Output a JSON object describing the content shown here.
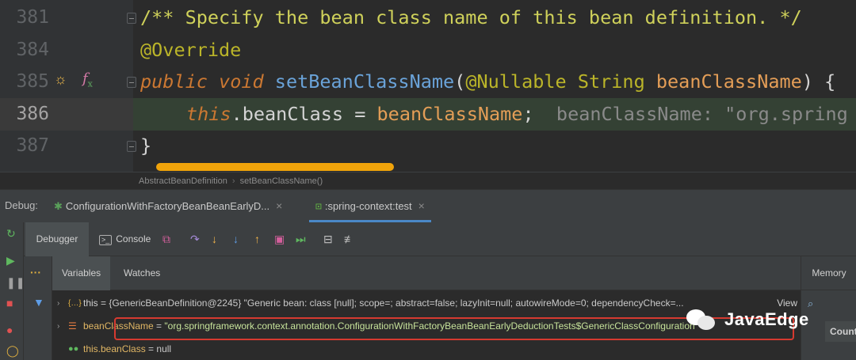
{
  "editor": {
    "lines": [
      {
        "num": "381",
        "doc": "/** Specify the bean class name of this bean definition. */"
      },
      {
        "num": "384",
        "annotation": "@Override"
      },
      {
        "num": "385",
        "kw_public": "public",
        "kw_void": "void",
        "method": "setBeanClassName",
        "open": "(",
        "nullable": "@Nullable",
        "type": "String",
        "param": "beanClassName",
        "close": ") {"
      },
      {
        "num": "386",
        "this": "this",
        "dot_field": ".beanClass",
        "assign": " = ",
        "value": "beanClassName",
        "semi": ";",
        "hint": "beanClassName: \"org.spring"
      },
      {
        "num": "387",
        "brace": "}"
      }
    ]
  },
  "breadcrumb": {
    "cls": "AbstractBeanDefinition",
    "sep": "›",
    "method": "setBeanClassName()"
  },
  "debug": {
    "label": "Debug:",
    "tabs": [
      {
        "label": "ConfigurationWithFactoryBeanBeanEarlyD...",
        "close": "×"
      },
      {
        "label": ":spring-context:test",
        "close": "×"
      }
    ],
    "debugger_tab": "Debugger",
    "console_tab": "Console",
    "console_icon": ">_",
    "variables_tab": "Variables",
    "watches_tab": "Watches",
    "memory": "Memory",
    "count": "Count",
    "variables": [
      {
        "arrow": "›",
        "name": "this",
        "eq": " = ",
        "value": "{GenericBeanDefinition@2245} \"Generic bean: class [null]; scope=; abstract=false; lazyInit=null; autowireMode=0; dependencyCheck=...",
        "view": "View"
      },
      {
        "arrow": "›",
        "name": "beanClassName",
        "eq": " = ",
        "value": "\"org.springframework.context.annotation.ConfigurationWithFactoryBeanBeanEarlyDeductionTests$GenericClassConfiguration\""
      },
      {
        "name": "this.beanClass",
        "eq": " = ",
        "value": "null"
      }
    ]
  },
  "watermark": {
    "text": "JavaEdge"
  }
}
